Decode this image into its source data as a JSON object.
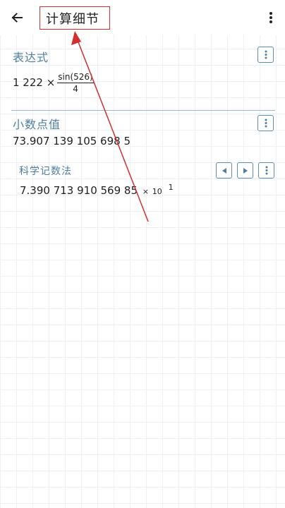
{
  "appbar": {
    "title": "计算细节",
    "back_icon": "arrow-left-icon",
    "menu_icon": "more-vertical-icon"
  },
  "expression": {
    "heading": "表达式",
    "prefix": "1 222 ×",
    "numerator": "sin(526)",
    "denominator": "4"
  },
  "decimal": {
    "heading": "小数点值",
    "value": "73.907 139 105 698 5"
  },
  "scientific": {
    "heading": "科学记数法",
    "mantissa": "7.390 713 910 569 85",
    "times": "×",
    "base": "10",
    "exponent": "1"
  },
  "colors": {
    "accent": "#4f7fa0",
    "annotation": "#d32f2f"
  }
}
